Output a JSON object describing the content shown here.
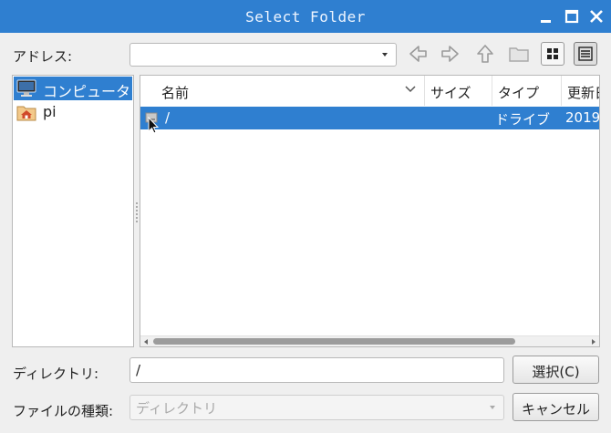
{
  "window": {
    "title": "Select Folder"
  },
  "address": {
    "label": "アドレス:",
    "value": ""
  },
  "places": {
    "items": [
      {
        "label": "コンピュータ",
        "icon": "computer-icon",
        "selected": true
      },
      {
        "label": "pi",
        "icon": "home-folder-icon",
        "selected": false
      }
    ]
  },
  "filelist": {
    "columns": [
      {
        "label": "名前"
      },
      {
        "label": "サイズ"
      },
      {
        "label": "タイプ"
      },
      {
        "label": "更新日"
      }
    ],
    "rows": [
      {
        "name": "/",
        "size": "",
        "type": "ドライブ",
        "modified": "2019",
        "icon": "drive-icon",
        "selected": true
      }
    ]
  },
  "directory": {
    "label": "ディレクトリ:",
    "value": "/"
  },
  "filetype": {
    "label": "ファイルの種類:",
    "value": "ディレクトリ"
  },
  "buttons": {
    "select_label": "選択(C)",
    "cancel_label": "キャンセル"
  },
  "colors": {
    "accent": "#2f7fd0",
    "window_bg": "#efefef"
  }
}
